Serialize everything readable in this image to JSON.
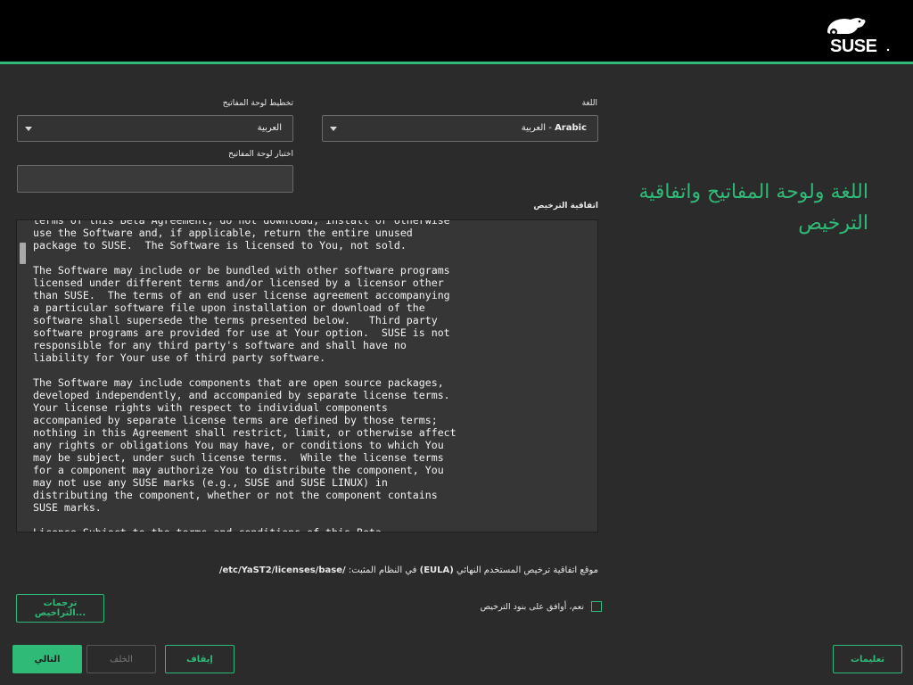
{
  "header": {
    "brand": "SUSE"
  },
  "page": {
    "heading": "اللغة ولوحة المفاتيح واتفاقية الترخيص"
  },
  "language": {
    "label": "اللغة",
    "value_en": "Arabic",
    "value_sep": " - ",
    "value_native": "العربية"
  },
  "keyboard": {
    "label": "تخطيط لوحة المفاتيح",
    "value": "العربية",
    "test_label": "اختبار لوحة المفاتيح",
    "test_value": ""
  },
  "license": {
    "label": "اتفاقية الترخيص",
    "lines": [
      "terms of this Beta Agreement, do not download, install or otherwise",
      "use the Software and, if applicable, return the entire unused",
      "package to SUSE.  The Software is licensed to You, not sold.",
      "",
      "The Software may include or be bundled with other software programs",
      "licensed under different terms and/or licensed by a licensor other",
      "than SUSE.  The terms of an end user license agreement accompanying",
      "a particular software file upon installation or download of the",
      "software shall supersede the terms presented below.   Third party",
      "software programs are provided for use at Your option.  SUSE is not",
      "responsible for any third party's software and shall have no",
      "liability for Your use of third party software.",
      "",
      "The Software may include components that are open source packages,",
      "developed independently, and accompanied by separate license terms.",
      "Your license rights with respect to individual components",
      "accompanied by separate license terms are defined by those terms;",
      "nothing in this Agreement shall restrict, limit, or otherwise affect",
      "any rights or obligations You may have, or conditions to which You",
      "may be subject, under such license terms.  While the license terms",
      "for a component may authorize You to distribute the component, You",
      "may not use any SUSE marks (e.g., SUSE and SUSE LINUX) in",
      "distributing the component, whether or not the component contains",
      "SUSE marks.",
      "",
      "License Subject to the terms and conditions of this Beta"
    ],
    "location_prefix": "موقع اتفاقية ترخيص المستخدم النهائي",
    "location_eula": "(EULA)",
    "location_mid": "في النظام المثبت:",
    "location_path": "/etc/YaST2/licenses/base/",
    "accept_label": "نعم، أوافق على بنود الترخيص",
    "accepted": false
  },
  "buttons": {
    "translations": "ترجمات التراخيص...",
    "next": "التالي",
    "back": "الخلف",
    "abort": "إيقاف",
    "help": "تعليمات"
  },
  "colors": {
    "accent": "#30ba78",
    "header_bg": "#000000",
    "body_bg": "#2b2b2b"
  }
}
